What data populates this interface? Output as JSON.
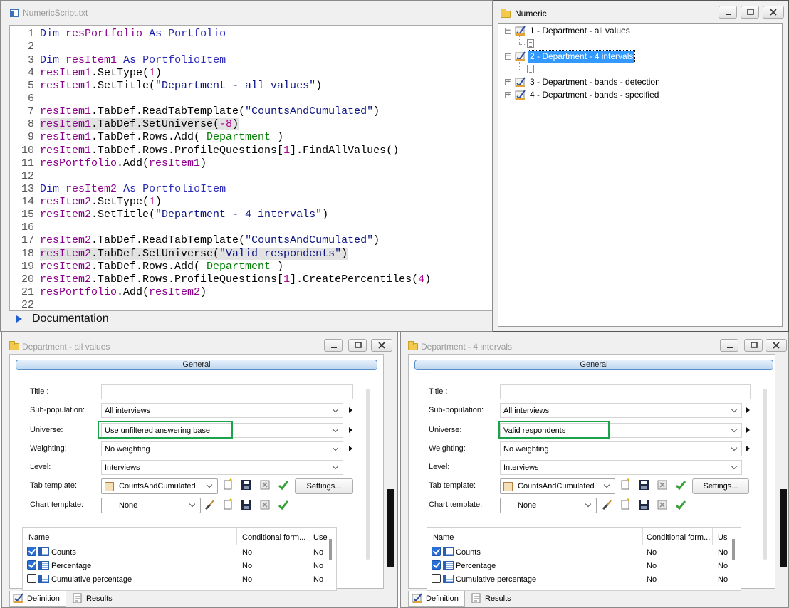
{
  "script_window": {
    "title": "NumericScript.txt",
    "lines": [
      {
        "n": "1"
      },
      {
        "n": "2"
      },
      {
        "n": "3"
      },
      {
        "n": "4"
      },
      {
        "n": "5"
      },
      {
        "n": "6"
      },
      {
        "n": "7"
      },
      {
        "n": "8"
      },
      {
        "n": "9"
      },
      {
        "n": "10"
      },
      {
        "n": "11"
      },
      {
        "n": "12"
      },
      {
        "n": "13"
      },
      {
        "n": "14"
      },
      {
        "n": "15"
      },
      {
        "n": "16"
      },
      {
        "n": "17"
      },
      {
        "n": "18"
      },
      {
        "n": "19"
      },
      {
        "n": "20"
      },
      {
        "n": "21"
      },
      {
        "n": "22"
      }
    ],
    "tokens": {
      "dim": "Dim",
      "as": "As",
      "resPortfolio": "resPortfolio",
      "Portfolio": "Portfolio",
      "PortfolioItem": "PortfolioItem",
      "resItem1": "resItem1",
      "resItem2": "resItem2",
      "SetType": ".SetType(",
      "one": "1",
      "close": ")",
      "SetTitle": ".SetTitle(",
      "title1": "\"Department - all values\"",
      "title2": "\"Department - 4 intervals\"",
      "ReadTab": ".TabDef.ReadTabTemplate(",
      "tpl": "\"CountsAndCumulated\"",
      "SetUniverse": ".TabDef.SetUniverse(",
      "minus8": "-8",
      "validResp": "\"Valid respondents\"",
      "RowsAdd": ".TabDef.Rows.Add( ",
      "Department": "Department",
      "closeSp": " )",
      "ProfQ": ".TabDef.Rows.ProfileQuestions[",
      "idx1": "1",
      "FindAll": "].FindAllValues()",
      "CreatePct": "].CreatePercentiles(",
      "four": "4",
      "Add": ".Add("
    },
    "documentation_label": "Documentation"
  },
  "tree_window": {
    "title": "Numeric",
    "items": [
      {
        "label": "1 - Department - all values",
        "expanded": true
      },
      {
        "label": "2 - Department - 4 intervals",
        "expanded": true,
        "selected": true
      },
      {
        "label": "3 - Department - bands - detection",
        "expanded": false
      },
      {
        "label": "4 - Department - bands - specified",
        "expanded": false
      }
    ]
  },
  "prop_windows": [
    {
      "title": "Department - all values",
      "section": "General",
      "labels": {
        "title": "Title :",
        "subpop": "Sub-population:",
        "universe": "Universe:",
        "weighting": "Weighting:",
        "level": "Level:",
        "tab_template": "Tab template:",
        "chart_template": "Chart template:"
      },
      "values": {
        "title": "",
        "subpop": "All interviews",
        "universe": "Use unfiltered answering base",
        "weighting": "No weighting",
        "level": "Interviews",
        "tab_template": "CountsAndCumulated",
        "chart_template": "None"
      },
      "settings_label": "Settings...",
      "grid": {
        "headers": [
          "Name",
          "Conditional form...",
          "Use"
        ],
        "rows": [
          {
            "name": "Counts",
            "cond": "No",
            "use": "No",
            "checked": true
          },
          {
            "name": "Percentage",
            "cond": "No",
            "use": "No",
            "checked": true
          },
          {
            "name": "Cumulative percentage",
            "cond": "No",
            "use": "No",
            "checked": false
          }
        ]
      },
      "tabs": [
        "Definition",
        "Results"
      ]
    },
    {
      "title": "Department - 4 intervals",
      "section": "General",
      "labels": {
        "title": "Title :",
        "subpop": "Sub-population:",
        "universe": "Universe:",
        "weighting": "Weighting:",
        "level": "Level:",
        "tab_template": "Tab template:",
        "chart_template": "Chart template:"
      },
      "values": {
        "title": "",
        "subpop": "All interviews",
        "universe": "Valid respondents",
        "weighting": "No weighting",
        "level": "Interviews",
        "tab_template": "CountsAndCumulated",
        "chart_template": "None"
      },
      "settings_label": "Settings...",
      "grid": {
        "headers": [
          "Name",
          "Conditional form...",
          "Us"
        ],
        "rows": [
          {
            "name": "Counts",
            "cond": "No",
            "use": "No",
            "checked": true
          },
          {
            "name": "Percentage",
            "cond": "No",
            "use": "No",
            "checked": true
          },
          {
            "name": "Cumulative percentage",
            "cond": "No",
            "use": "No",
            "checked": false
          }
        ]
      },
      "tabs": [
        "Definition",
        "Results"
      ]
    }
  ],
  "colors": {
    "highlight_green": "#1aa34a",
    "selection_blue": "#3399ff",
    "keyword_blue": "#1a1ab0",
    "variable_purple": "#8b008b",
    "identifier_green": "#008000"
  }
}
